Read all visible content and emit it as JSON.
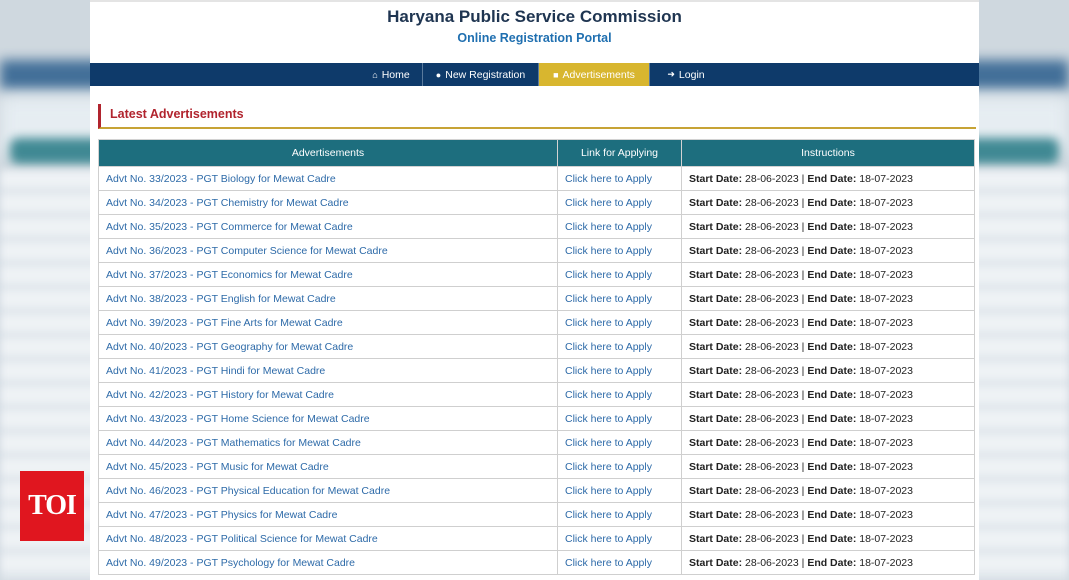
{
  "header": {
    "title": "Haryana Public Service Commission",
    "subtitle": "Online Registration Portal"
  },
  "nav": {
    "items": [
      {
        "label": "Home",
        "icon": "home-icon"
      },
      {
        "label": "New Registration",
        "icon": "user-icon"
      },
      {
        "label": "Advertisements",
        "icon": "document-icon",
        "active": true
      },
      {
        "label": "Login",
        "icon": "login-icon"
      }
    ]
  },
  "section": {
    "title": "Latest Advertisements"
  },
  "table": {
    "headers": [
      "Advertisements",
      "Link for Applying",
      "Instructions"
    ],
    "start_label": "Start Date:",
    "end_label": "End Date:",
    "separator": " | ",
    "rows": [
      {
        "adv": "Advt No. 33/2023 - PGT Biology for Mewat Cadre",
        "link": "Click here to Apply",
        "start": "28-06-2023",
        "end": "18-07-2023"
      },
      {
        "adv": "Advt No. 34/2023 - PGT Chemistry for Mewat Cadre",
        "link": "Click here to Apply",
        "start": "28-06-2023",
        "end": "18-07-2023"
      },
      {
        "adv": "Advt No. 35/2023 - PGT Commerce for Mewat Cadre",
        "link": "Click here to Apply",
        "start": "28-06-2023",
        "end": "18-07-2023"
      },
      {
        "adv": "Advt No. 36/2023 - PGT Computer Science for Mewat Cadre",
        "link": "Click here to Apply",
        "start": "28-06-2023",
        "end": "18-07-2023"
      },
      {
        "adv": "Advt No. 37/2023 - PGT Economics for Mewat Cadre",
        "link": "Click here to Apply",
        "start": "28-06-2023",
        "end": "18-07-2023"
      },
      {
        "adv": "Advt No. 38/2023 - PGT English for Mewat Cadre",
        "link": "Click here to Apply",
        "start": "28-06-2023",
        "end": "18-07-2023"
      },
      {
        "adv": "Advt No. 39/2023 - PGT Fine Arts for Mewat Cadre",
        "link": "Click here to Apply",
        "start": "28-06-2023",
        "end": "18-07-2023"
      },
      {
        "adv": "Advt No. 40/2023 - PGT Geography for Mewat Cadre",
        "link": "Click here to Apply",
        "start": "28-06-2023",
        "end": "18-07-2023"
      },
      {
        "adv": "Advt No. 41/2023 - PGT Hindi for Mewat Cadre",
        "link": "Click here to Apply",
        "start": "28-06-2023",
        "end": "18-07-2023"
      },
      {
        "adv": "Advt No. 42/2023 - PGT History for Mewat Cadre",
        "link": "Click here to Apply",
        "start": "28-06-2023",
        "end": "18-07-2023"
      },
      {
        "adv": "Advt No. 43/2023 - PGT Home Science for Mewat Cadre",
        "link": "Click here to Apply",
        "start": "28-06-2023",
        "end": "18-07-2023"
      },
      {
        "adv": "Advt No. 44/2023 - PGT Mathematics for Mewat Cadre",
        "link": "Click here to Apply",
        "start": "28-06-2023",
        "end": "18-07-2023"
      },
      {
        "adv": "Advt No. 45/2023 - PGT Music for Mewat Cadre",
        "link": "Click here to Apply",
        "start": "28-06-2023",
        "end": "18-07-2023"
      },
      {
        "adv": "Advt No. 46/2023 - PGT Physical Education for Mewat Cadre",
        "link": "Click here to Apply",
        "start": "28-06-2023",
        "end": "18-07-2023"
      },
      {
        "adv": "Advt No. 47/2023 - PGT Physics for Mewat Cadre",
        "link": "Click here to Apply",
        "start": "28-06-2023",
        "end": "18-07-2023"
      },
      {
        "adv": "Advt No. 48/2023 - PGT Political Science for Mewat Cadre",
        "link": "Click here to Apply",
        "start": "28-06-2023",
        "end": "18-07-2023"
      },
      {
        "adv": "Advt No. 49/2023 - PGT Psychology for Mewat Cadre",
        "link": "Click here to Apply",
        "start": "28-06-2023",
        "end": "18-07-2023"
      }
    ]
  },
  "watermark": {
    "label": "TOI"
  },
  "colors": {
    "nav_bg": "#0e3a6a",
    "nav_active": "#d8b62f",
    "table_header": "#1d6e7e",
    "link": "#2d6aa8",
    "section_title": "#b1242e",
    "watermark": "#e0161f"
  }
}
